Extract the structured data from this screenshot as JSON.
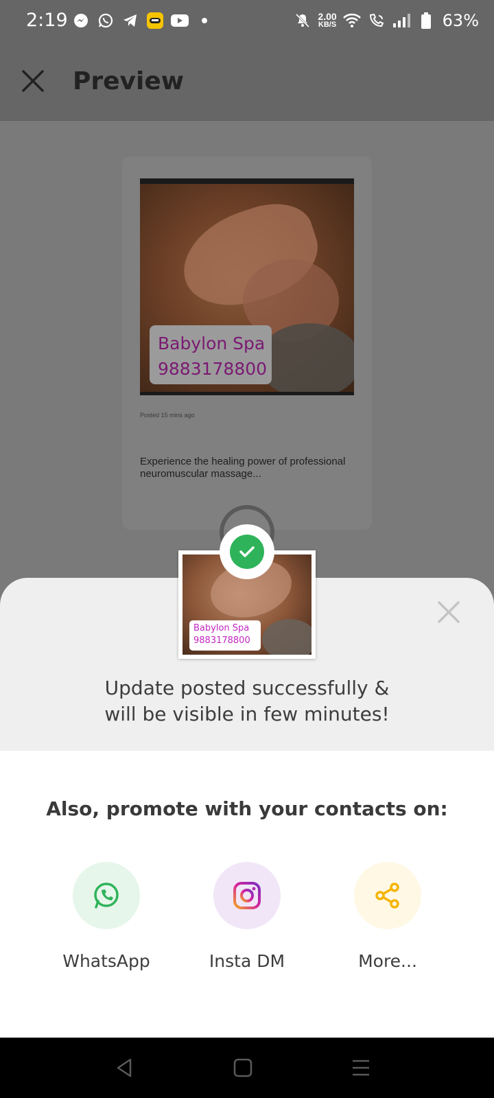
{
  "status_bar": {
    "time": "2:19",
    "net_speed_value": "2.00",
    "net_speed_unit": "KB/S",
    "battery": "63%",
    "left_icons": [
      "messenger-icon",
      "whatsapp-icon",
      "telegram-icon",
      "chat-app-icon",
      "youtube-icon",
      "dot-icon"
    ],
    "right_icons": [
      "mute-icon",
      "wifi-icon",
      "wifi-call-icon",
      "signal-icon",
      "battery-icon"
    ]
  },
  "app_bar": {
    "title": "Preview"
  },
  "post": {
    "business_name": "Babylon Spa",
    "phone": "9883178800",
    "posted_time": "Posted 15 mins ago",
    "description": "Experience the healing power of professional neuromuscular massage..."
  },
  "sheet": {
    "success_line1": "Update posted successfully &",
    "success_line2": "will be visible in few minutes!",
    "promote_title": "Also, promote with your contacts on:",
    "share_options": [
      {
        "label": "WhatsApp",
        "icon": "whatsapp-icon",
        "color": "#2fb35a",
        "bg": "#e6f6ea"
      },
      {
        "label": "Insta DM",
        "icon": "instagram-icon",
        "color": "#c13584",
        "bg": "#f1e6f7"
      },
      {
        "label": "More...",
        "icon": "share-icon",
        "color": "#f5b400",
        "bg": "#fff8e5"
      }
    ]
  },
  "nav_bar": {
    "buttons": [
      "back-icon",
      "home-icon",
      "menu-icon"
    ]
  },
  "colors": {
    "success_green": "#2fb35a",
    "label_magenta": "#c226c0",
    "scrim": "#7a7a7a"
  }
}
